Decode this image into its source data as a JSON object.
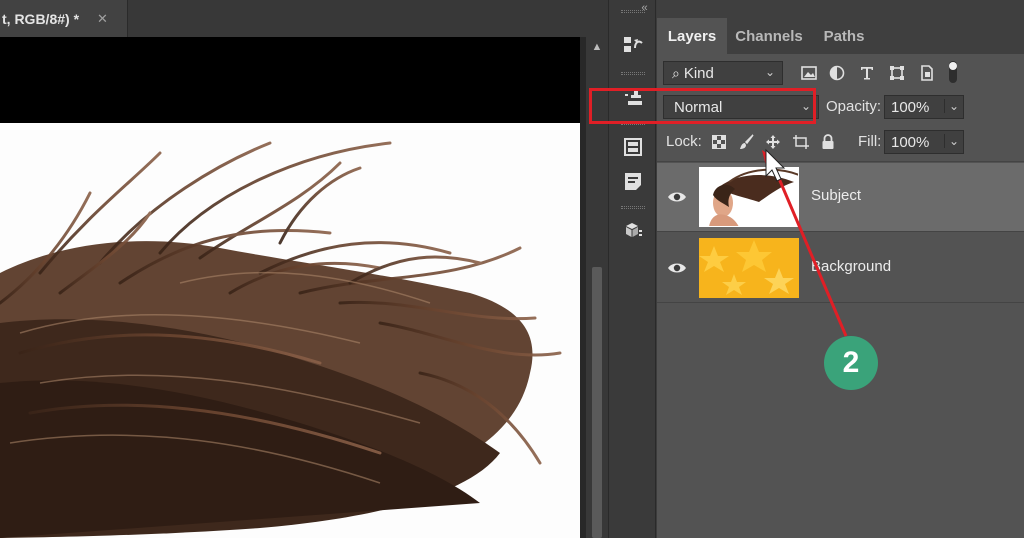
{
  "document": {
    "tab_title": "t, RGB/8#) *",
    "tab_close": "✕"
  },
  "scrollbar": {
    "up_arrow": "▲"
  },
  "panel": {
    "collapse_arrows": "‹‹",
    "tabs": [
      {
        "label": "Layers",
        "active": true
      },
      {
        "label": "Channels",
        "active": false
      },
      {
        "label": "Paths",
        "active": false
      }
    ],
    "filter": {
      "kind_value": "Kind",
      "filter_icons": [
        "image-filter-icon",
        "adjustment-filter-icon",
        "type-filter-icon",
        "shape-filter-icon",
        "smart-object-filter-icon",
        "filter-toggle-icon"
      ]
    },
    "blend": {
      "mode_value": "Normal",
      "opacity_label": "Opacity:",
      "opacity_value": "100%"
    },
    "lock": {
      "label": "Lock:",
      "icons": [
        "lock-transparent-pixels-icon",
        "lock-image-pixels-icon",
        "lock-position-icon",
        "lock-artboard-icon",
        "lock-all-icon"
      ],
      "fill_label": "Fill:",
      "fill_value": "100%"
    },
    "layers": [
      {
        "name": "Subject",
        "selected": true,
        "visible": true,
        "thumb": "woman-hair-thumbnail"
      },
      {
        "name": "Background",
        "selected": false,
        "visible": true,
        "thumb": "yellow-stars-thumbnail"
      }
    ]
  },
  "annotation": {
    "badge_number": "2",
    "highlight_color": "#e01f26",
    "badge_color": "#3aa37a"
  }
}
